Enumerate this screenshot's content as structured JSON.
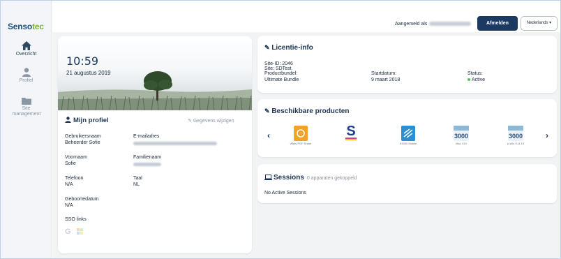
{
  "brand": {
    "logo_main": "Senso",
    "logo_accent": "tec"
  },
  "sidebar": {
    "items": [
      {
        "label": "Overzicht",
        "icon": "home-icon",
        "active": true
      },
      {
        "label": "Profiel",
        "icon": "user-icon",
        "active": false
      },
      {
        "label": "Site management",
        "icon": "folder-icon",
        "active": false
      }
    ]
  },
  "header": {
    "logged_in_as": "Aangemeld als",
    "logout_label": "Afmelden",
    "language_label": "Nederlands ▾"
  },
  "profile": {
    "time": "10:59",
    "date": "21 augustus 2019",
    "title": "Mijn profiel",
    "edit_label": "Gegevens wijzigen",
    "fields": {
      "username_label": "Gebruikersnaam",
      "username_value": "Beheerder Sofie",
      "email_label": "E-mailadres",
      "firstname_label": "Voornaam",
      "firstname_value": "Sofie",
      "lastname_label": "Familienaam",
      "phone_label": "Telefoon",
      "phone_value": "N/A",
      "language_label": "Taal",
      "language_value": "NL",
      "birthdate_label": "Geboortedatum",
      "birthdate_value": "N/A",
      "sso_label": "SSO links"
    }
  },
  "license": {
    "title": "Licentie-info",
    "site_id": "Site-ID: 2046",
    "site": "Site: SDTest",
    "bundle_label": "Productbundel:",
    "bundle_value": "Ultimate Bundle",
    "start_label": "Startdatum:",
    "start_value": "9 maart 2018",
    "status_label": "Status:",
    "status_value": "Active"
  },
  "products": {
    "title": "Beschikbare producten",
    "items": [
      {
        "name": "Wiply PDF Share",
        "icon": "wiply-icon"
      },
      {
        "name": "",
        "icon": "sprint-s-icon"
      },
      {
        "name": "K3000 Mobile",
        "icon": "k3000-mobile-icon"
      },
      {
        "name": "Mac V10",
        "icon": "kurzweil-3000-mac-icon"
      },
      {
        "name": "p-Win V14.15",
        "icon": "kurzweil-3000-win-icon"
      }
    ]
  },
  "sessions": {
    "title": "Sessions",
    "count_text": "0 apparaten gekoppeld",
    "empty_text": "No Active Sessions"
  },
  "colors": {
    "primary": "#1c3a61",
    "accent_green": "#7ab040",
    "status_green": "#5dbb5a",
    "content_bg": "#f2f3f5"
  }
}
